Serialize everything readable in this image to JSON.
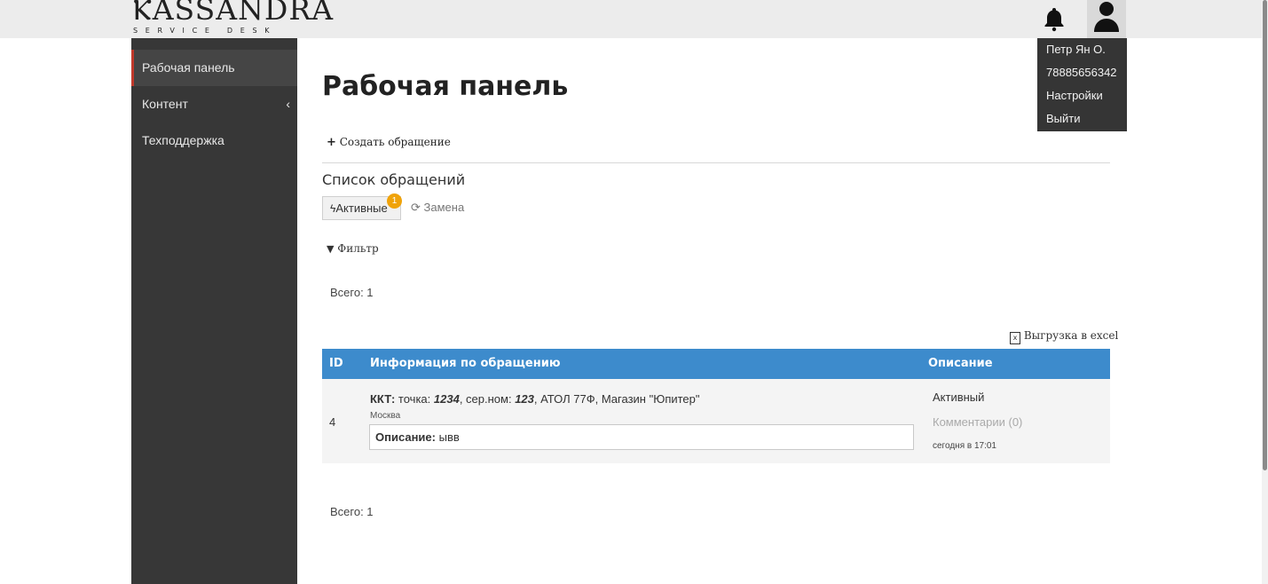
{
  "logo": {
    "main": "ⲔASSANDRA",
    "sub": "SERVICE DESK"
  },
  "header": {
    "bell_icon": "bell-icon",
    "user_icon": "user-icon"
  },
  "user_menu": {
    "name": "Петр Ян О.",
    "phone": "78885656342",
    "settings": "Настройки",
    "logout": "Выйти"
  },
  "sidebar": {
    "items": [
      {
        "label": "Рабочая панель",
        "active": true
      },
      {
        "label": "Контент",
        "chevron": "‹"
      },
      {
        "label": "Техподдержка"
      }
    ]
  },
  "main": {
    "title": "Рабочая панель",
    "create_label": "Создать обращение",
    "list_title": "Список обращений",
    "tabs": [
      {
        "label": "Активные",
        "badge": "1"
      },
      {
        "label": "Замена"
      }
    ],
    "filter_label": "Фильтр",
    "total_top": "Всего: 1",
    "total_bottom": "Всего: 1",
    "excel_label": "Выгрузка в excel"
  },
  "table": {
    "headers": [
      "ID",
      "Информация по обращению",
      "Описание"
    ],
    "rows": [
      {
        "id": "4",
        "kkt_label": "ККТ:",
        "point_text": "точка:",
        "point_value": "1234",
        "serial_text": ", сер.ном:",
        "serial_value": "123",
        "rest": ", АТОЛ 77Ф, Магазин \"Юпитер\"",
        "city": "Москва",
        "desc_label": "Описание:",
        "desc_value": "ывв",
        "status": "Активный",
        "comments": "Комментарии (0)",
        "time": "сегодня в 17:01"
      }
    ]
  },
  "colors": {
    "sidebar_bg": "#373737",
    "table_header": "#3d8bcc",
    "active_marker": "#c0392b",
    "badge": "#f0a30a"
  }
}
